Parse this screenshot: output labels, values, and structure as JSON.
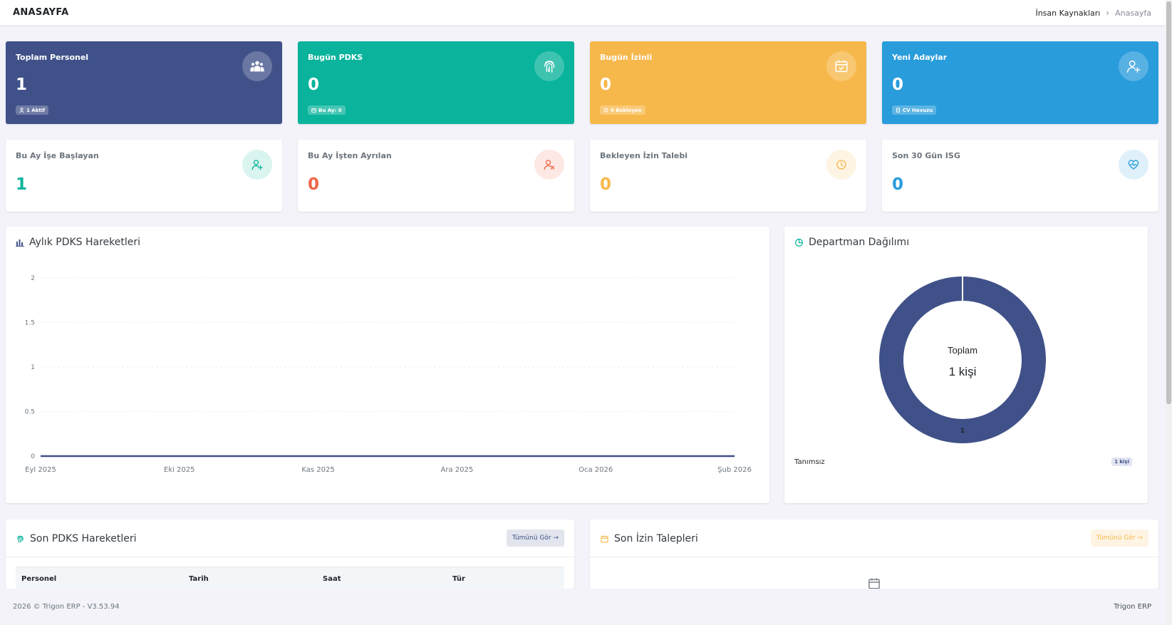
{
  "header": {
    "title": "ANASAYFA",
    "breadcrumb": {
      "parent": "İnsan Kaynakları",
      "separator": "›",
      "current": "Anasayfa"
    }
  },
  "stats": [
    {
      "title": "Toplam Personel",
      "value": "1",
      "badge": "1 Aktif",
      "icon": "users-icon",
      "color": "#405189"
    },
    {
      "title": "Bugün PDKS",
      "value": "0",
      "badge": "Bu Ay: 0",
      "icon": "fingerprint-icon",
      "color": "#0ab39c"
    },
    {
      "title": "Bugün İzinli",
      "value": "0",
      "badge": "0 Bekleyen",
      "icon": "calendar-check-icon",
      "color": "#f7b84b"
    },
    {
      "title": "Yeni Adaylar",
      "value": "0",
      "badge": "CV Havuzu",
      "icon": "user-plus-icon",
      "color": "#299cdb"
    }
  ],
  "mini_stats": [
    {
      "title": "Bu Ay İşe Başlayan",
      "value": "1",
      "icon": "user-add-icon",
      "color": "#0ab39c"
    },
    {
      "title": "Bu Ay İşten Ayrılan",
      "value": "0",
      "icon": "user-remove-icon",
      "color": "#f06548"
    },
    {
      "title": "Bekleyen İzin Talebi",
      "value": "0",
      "icon": "clock-icon",
      "color": "#f7b84b"
    },
    {
      "title": "Son 30 Gün ISG",
      "value": "0",
      "icon": "heart-pulse-icon",
      "color": "#299cdb"
    }
  ],
  "pdks_chart": {
    "title": "Aylık PDKS Hareketleri",
    "icon": "bar-chart-icon",
    "chart_data": {
      "type": "line",
      "x": [
        "Eyl 2025",
        "Eki 2025",
        "Kas 2025",
        "Ara 2025",
        "Oca 2026",
        "Şub 2026"
      ],
      "series": [
        {
          "values": [
            0,
            0,
            0,
            0,
            0,
            0
          ],
          "color": "#405189"
        }
      ],
      "y_ticks": [
        "0",
        "0.5",
        "1",
        "1.5",
        "2"
      ],
      "ylim": [
        0,
        2
      ],
      "grid": true
    }
  },
  "department_chart": {
    "title": "Departman Dağılımı",
    "icon": "pie-chart-icon",
    "center_label": "Toplam",
    "center_value": "1 kişi",
    "chart_data": {
      "type": "pie",
      "categories": [
        "Tanımsız"
      ],
      "values": [
        1
      ],
      "data_labels": [
        "1"
      ],
      "colors": [
        "#405189"
      ]
    },
    "legend": [
      {
        "name": "Tanımsız",
        "badge": "1 kişi"
      }
    ]
  },
  "recent_pdks": {
    "title": "Son PDKS Hareketleri",
    "icon": "fingerprint-icon",
    "button_label": "Tümünü Gör →",
    "columns": [
      "Personel",
      "Tarih",
      "Saat",
      "Tür"
    ]
  },
  "recent_leaves": {
    "title": "Son İzin Talepleri",
    "icon": "calendar-icon",
    "button_label": "Tümünü Gör →",
    "empty_icon": "calendar-empty-icon"
  },
  "footer": {
    "copyright": "2026 © Trigon ERP - V3.53.94",
    "brand": "Trigon ERP"
  }
}
